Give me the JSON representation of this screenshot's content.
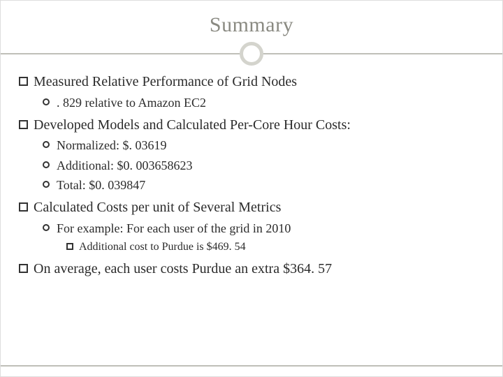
{
  "title": "Summary",
  "bullets": {
    "b1": {
      "text": "Measured Relative Performance of Grid Nodes",
      "sub1": ". 829 relative to Amazon EC2"
    },
    "b2": {
      "text": "Developed Models and Calculated Per-Core Hour Costs:",
      "sub1": "Normalized: $. 03619",
      "sub2": "Additional: $0. 003658623",
      "sub3": "Total:  $0. 039847"
    },
    "b3": {
      "text": "Calculated Costs per unit of Several Metrics",
      "sub1": "For example: For each user of the grid in 2010",
      "subsub1": "Additional cost to Purdue is $469. 54"
    },
    "b4": {
      "text": "On average, each user costs Purdue an extra $364. 57"
    }
  }
}
